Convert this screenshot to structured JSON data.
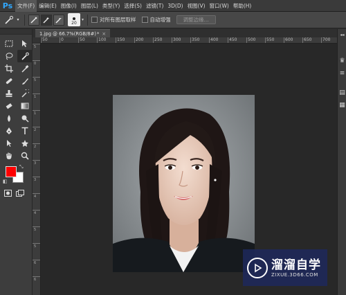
{
  "app": {
    "logo": "Ps"
  },
  "menu": [
    {
      "label": "文件(F)"
    },
    {
      "label": "编辑(E)"
    },
    {
      "label": "图像(I)"
    },
    {
      "label": "图层(L)"
    },
    {
      "label": "类型(Y)"
    },
    {
      "label": "选择(S)"
    },
    {
      "label": "滤镜(T)"
    },
    {
      "label": "3D(D)"
    },
    {
      "label": "视图(V)"
    },
    {
      "label": "窗口(W)"
    },
    {
      "label": "帮助(H)"
    }
  ],
  "options": {
    "brush_size": "20",
    "sample_all_layers_label": "对所有图层取样",
    "auto_enhance_label": "自动增强",
    "refine_edge_label": "调整边缘..."
  },
  "document": {
    "tab_title": "1.jpg @ 66.7%(RGB/8#)",
    "tab_modified": "*",
    "close_glyph": "×"
  },
  "ruler": {
    "h_ticks": [
      "50",
      "0",
      "50",
      "100",
      "150",
      "200",
      "250",
      "300",
      "350",
      "400",
      "450",
      "500",
      "550",
      "600",
      "650",
      "700"
    ],
    "v_ticks": [
      "5",
      "0",
      "5",
      "1",
      "1",
      "2",
      "2",
      "3",
      "3",
      "4",
      "4",
      "5",
      "5",
      "6",
      "6"
    ]
  },
  "colors": {
    "foreground": "#ff0000",
    "background": "#ffffff",
    "accent": "#31a8ff"
  },
  "watermark": {
    "title": "溜溜自学",
    "subtitle": "ZIXUE.3D66.COM"
  }
}
